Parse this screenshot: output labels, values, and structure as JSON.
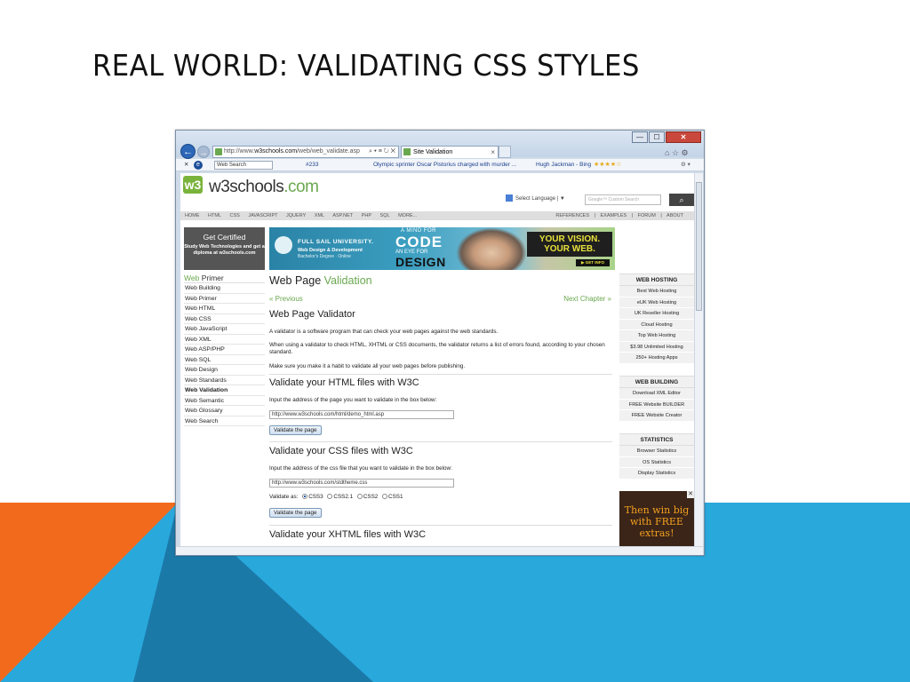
{
  "slide": {
    "title": "REAL WORLD: VALIDATING CSS STYLES",
    "colors": {
      "orange": "#f26b1d",
      "blue": "#29a8dc",
      "dark_blue": "#1b79a8"
    }
  },
  "browser": {
    "url_prefix": "http://www.",
    "url_domain": "w3schools.com",
    "url_path": "/web/web_validate.asp",
    "address_controls": "⌕ ▾ ≡ ↻ ✕",
    "tab_label": "Site Validation",
    "tab_close": "×",
    "minimize": "—",
    "maximize": "☐",
    "close": "✕",
    "chrome_icons": "⌂ ☆ ⚙"
  },
  "command_bar": {
    "close": "✕",
    "search_placeholder": "Web Search",
    "count": "#233",
    "news1": "Olympic sprinter Oscar Pistorius charged with murder ...",
    "news2": "Hugh Jackman - Bing",
    "stars": "★★★★☆",
    "gear": "⚙ ▾"
  },
  "site": {
    "logo_mark": "w3",
    "logo_name": "w3schools",
    "logo_tld": ".com",
    "select_language": "Select Language | ▼",
    "custom_search": "Google™ Custom Search",
    "search_btn": "⌕",
    "topnav": [
      "HOME",
      "HTML",
      "CSS",
      "JAVASCRIPT",
      "JQUERY",
      "XML",
      "ASP.NET",
      "PHP",
      "SQL",
      "MORE..."
    ],
    "topnav_right": [
      "REFERENCES",
      "|",
      "EXAMPLES",
      "|",
      "FORUM",
      "|",
      "ABOUT"
    ],
    "cert_title": "Get Certified",
    "cert_sub": "Study Web Technologies and get a diploma at w3schools.com",
    "banner": {
      "university": "FULL SAIL UNIVERSITY.",
      "degree": "Web Design & Development",
      "bachelor": "Bachelor's Degree · Online",
      "a_mind_for": "A MIND FOR",
      "code": "CODE",
      "an_eye_for": "AN EYE FOR",
      "design": "DESIGN",
      "tagline1": "YOUR VISION.",
      "tagline2": "YOUR WEB.",
      "cta": "▶ GET INFO"
    },
    "sidebar_head_green": "Web",
    "sidebar_head_rest": " Primer",
    "sidebar_items": [
      "Web Building",
      "Web Primer",
      "Web HTML",
      "Web CSS",
      "Web JavaScript",
      "Web XML",
      "Web ASP/PHP",
      "Web SQL",
      "Web Design",
      "Web Standards",
      "Web Validation",
      "Web Semantic",
      "Web Glossary",
      "Web Search"
    ],
    "main": {
      "title_a": "Web Page ",
      "title_b": "Validation",
      "prev": "« Previous",
      "next": "Next Chapter »",
      "h_validator": "Web Page Validator",
      "p1": "A validator is a software program that can check your web pages against the web standards.",
      "p2": "When using a validator to check HTML, XHTML or CSS documents, the validator returns a list of errors found, according to your chosen standard.",
      "p3": "Make sure you make it a habit to validate all your web pages before publishing.",
      "h_html": "Validate your HTML files with W3C",
      "p_html": "Input the address of the page you want to validate in the box below:",
      "html_url": "http://www.w3schools.com/html/demo_html.asp",
      "btn": "Validate the page",
      "h_css": "Validate your CSS files with W3C",
      "p_css": "Input the address of the css file that you want to validate in the box below:",
      "css_url": "http://www.w3schools.com/stdtheme.css",
      "validate_as": "Validate as:",
      "radio_options": [
        "CSS3",
        "CSS2.1",
        "CSS2",
        "CSS1"
      ],
      "selected": "CSS3",
      "h_cut": "Validate your XHTML files with W3C"
    },
    "web_hosting": {
      "head": "WEB HOSTING",
      "items": [
        "Best Web Hosting",
        "eUK Web Hosting",
        "UK Reseller Hosting",
        "Cloud Hosting",
        "Top Web Hosting",
        "$3.98 Unlimited Hosting",
        "250+ Hosting Apps"
      ]
    },
    "web_building": {
      "head": "WEB BUILDING",
      "items": [
        "Download XML Editor",
        "FREE Website BUILDER",
        "FREE Website Creator"
      ]
    },
    "statistics": {
      "head": "STATISTICS",
      "items": [
        "Browser Statistics",
        "OS Statistics",
        "Display Statistics"
      ]
    },
    "ad_text": "Then win big with FREE extras!",
    "ad_close": "✕"
  }
}
